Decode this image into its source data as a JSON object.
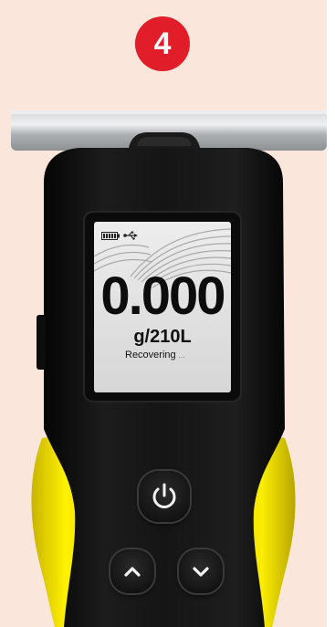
{
  "step": {
    "number": "4",
    "color": "#e11d2a"
  },
  "display": {
    "reading": "0.000",
    "unit": "g/210L",
    "status": "Recovering",
    "status_dots": "...",
    "icons": [
      "battery-icon",
      "usb-icon"
    ]
  },
  "device": {
    "body_color": "#121212",
    "grip_color": "#f5e400",
    "mouthpiece_color": "#b9bcbf",
    "background_color": "#fbe6dc"
  },
  "buttons": [
    {
      "name": "power-button",
      "icon": "power-icon"
    },
    {
      "name": "up-button",
      "icon": "chevron-up-icon"
    },
    {
      "name": "down-button",
      "icon": "chevron-down-icon"
    }
  ]
}
